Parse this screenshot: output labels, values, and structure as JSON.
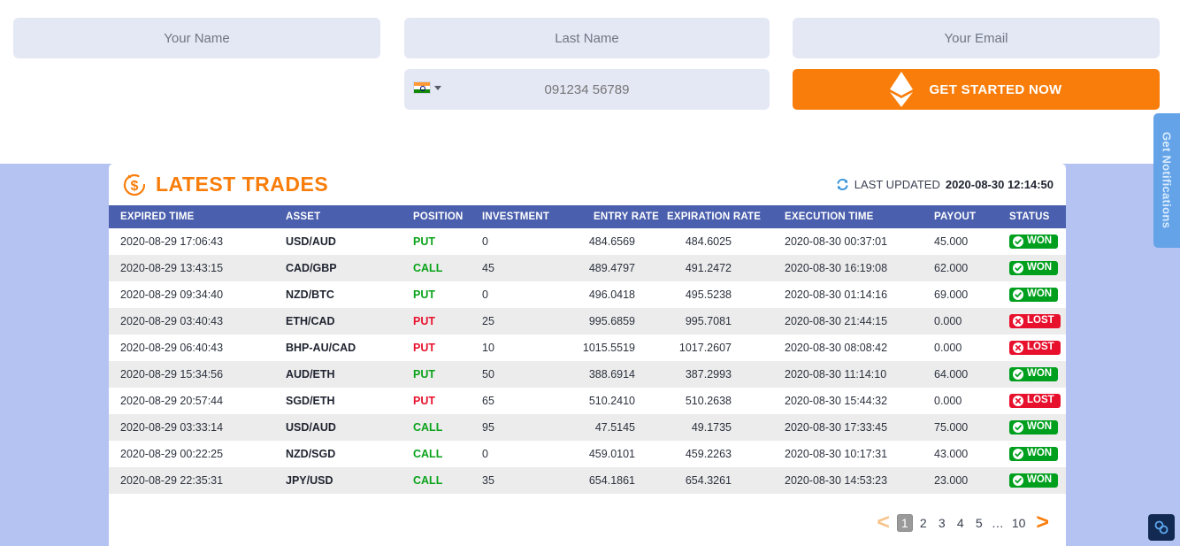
{
  "signup": {
    "name_placeholder": "Your Name",
    "name_value": "",
    "last_placeholder": "Last Name",
    "last_value": "",
    "email_placeholder": "Your Email",
    "email_value": "",
    "phone_placeholder": "091234 56789",
    "phone_value": "",
    "phone_country": "India",
    "cta_label": "GET STARTED NOW",
    "cta_color": "#f97d0a"
  },
  "panel": {
    "title": "LATEST TRADES",
    "title_color": "#f97d0a",
    "last_updated_label": "LAST UPDATED",
    "last_updated_value": "2020-08-30 12:14:50"
  },
  "table": {
    "header_bg": "#4a5fad",
    "columns": [
      "EXPIRED TIME",
      "ASSET",
      "POSITION",
      "INVESTMENT",
      "ENTRY RATE",
      "EXPIRATION RATE",
      "EXECUTION TIME",
      "PAYOUT",
      "STATUS"
    ],
    "rows": [
      {
        "expired_time": "2020-08-29 17:06:43",
        "asset": "USD/AUD",
        "position": "PUT",
        "position_color": "#0aa31a",
        "investment": "0",
        "entry_rate": "484.6569",
        "expiration_rate": "484.6025",
        "execution_time": "2020-08-30 00:37:01",
        "payout": "45.000",
        "status": "WON"
      },
      {
        "expired_time": "2020-08-29 13:43:15",
        "asset": "CAD/GBP",
        "position": "CALL",
        "position_color": "#0aa31a",
        "investment": "45",
        "entry_rate": "489.4797",
        "expiration_rate": "491.2472",
        "execution_time": "2020-08-30 16:19:08",
        "payout": "62.000",
        "status": "WON"
      },
      {
        "expired_time": "2020-08-29 09:34:40",
        "asset": "NZD/BTC",
        "position": "PUT",
        "position_color": "#0aa31a",
        "investment": "0",
        "entry_rate": "496.0418",
        "expiration_rate": "495.5238",
        "execution_time": "2020-08-30 01:14:16",
        "payout": "69.000",
        "status": "WON"
      },
      {
        "expired_time": "2020-08-29 03:40:43",
        "asset": "ETH/CAD",
        "position": "PUT",
        "position_color": "#e8112d",
        "investment": "25",
        "entry_rate": "995.6859",
        "expiration_rate": "995.7081",
        "execution_time": "2020-08-30 21:44:15",
        "payout": "0.000",
        "status": "LOST"
      },
      {
        "expired_time": "2020-08-29 06:40:43",
        "asset": "BHP-AU/CAD",
        "position": "PUT",
        "position_color": "#e8112d",
        "investment": "10",
        "entry_rate": "1015.5519",
        "expiration_rate": "1017.2607",
        "execution_time": "2020-08-30 08:08:42",
        "payout": "0.000",
        "status": "LOST"
      },
      {
        "expired_time": "2020-08-29 15:34:56",
        "asset": "AUD/ETH",
        "position": "PUT",
        "position_color": "#0aa31a",
        "investment": "50",
        "entry_rate": "388.6914",
        "expiration_rate": "387.2993",
        "execution_time": "2020-08-30 11:14:10",
        "payout": "64.000",
        "status": "WON"
      },
      {
        "expired_time": "2020-08-29 20:57:44",
        "asset": "SGD/ETH",
        "position": "PUT",
        "position_color": "#e8112d",
        "investment": "65",
        "entry_rate": "510.2410",
        "expiration_rate": "510.2638",
        "execution_time": "2020-08-30 15:44:32",
        "payout": "0.000",
        "status": "LOST"
      },
      {
        "expired_time": "2020-08-29 03:33:14",
        "asset": "USD/AUD",
        "position": "CALL",
        "position_color": "#0aa31a",
        "investment": "95",
        "entry_rate": "47.5145",
        "expiration_rate": "49.1735",
        "execution_time": "2020-08-30 17:33:45",
        "payout": "75.000",
        "status": "WON"
      },
      {
        "expired_time": "2020-08-29 00:22:25",
        "asset": "NZD/SGD",
        "position": "CALL",
        "position_color": "#0aa31a",
        "investment": "0",
        "entry_rate": "459.0101",
        "expiration_rate": "459.2263",
        "execution_time": "2020-08-30 10:17:31",
        "payout": "43.000",
        "status": "WON"
      },
      {
        "expired_time": "2020-08-29 22:35:31",
        "asset": "JPY/USD",
        "position": "CALL",
        "position_color": "#0aa31a",
        "investment": "35",
        "entry_rate": "654.1861",
        "expiration_rate": "654.3261",
        "execution_time": "2020-08-30 14:53:23",
        "payout": "23.000",
        "status": "WON"
      }
    ]
  },
  "pagination": {
    "prev": "<",
    "next": ">",
    "pages": [
      "1",
      "2",
      "3",
      "4",
      "5"
    ],
    "ellipsis": "…",
    "last_page": "10",
    "active": "1"
  },
  "notifications_tab": {
    "label": "Get Notifications"
  },
  "chain_widget": {
    "icon": "chain-link-icon"
  }
}
